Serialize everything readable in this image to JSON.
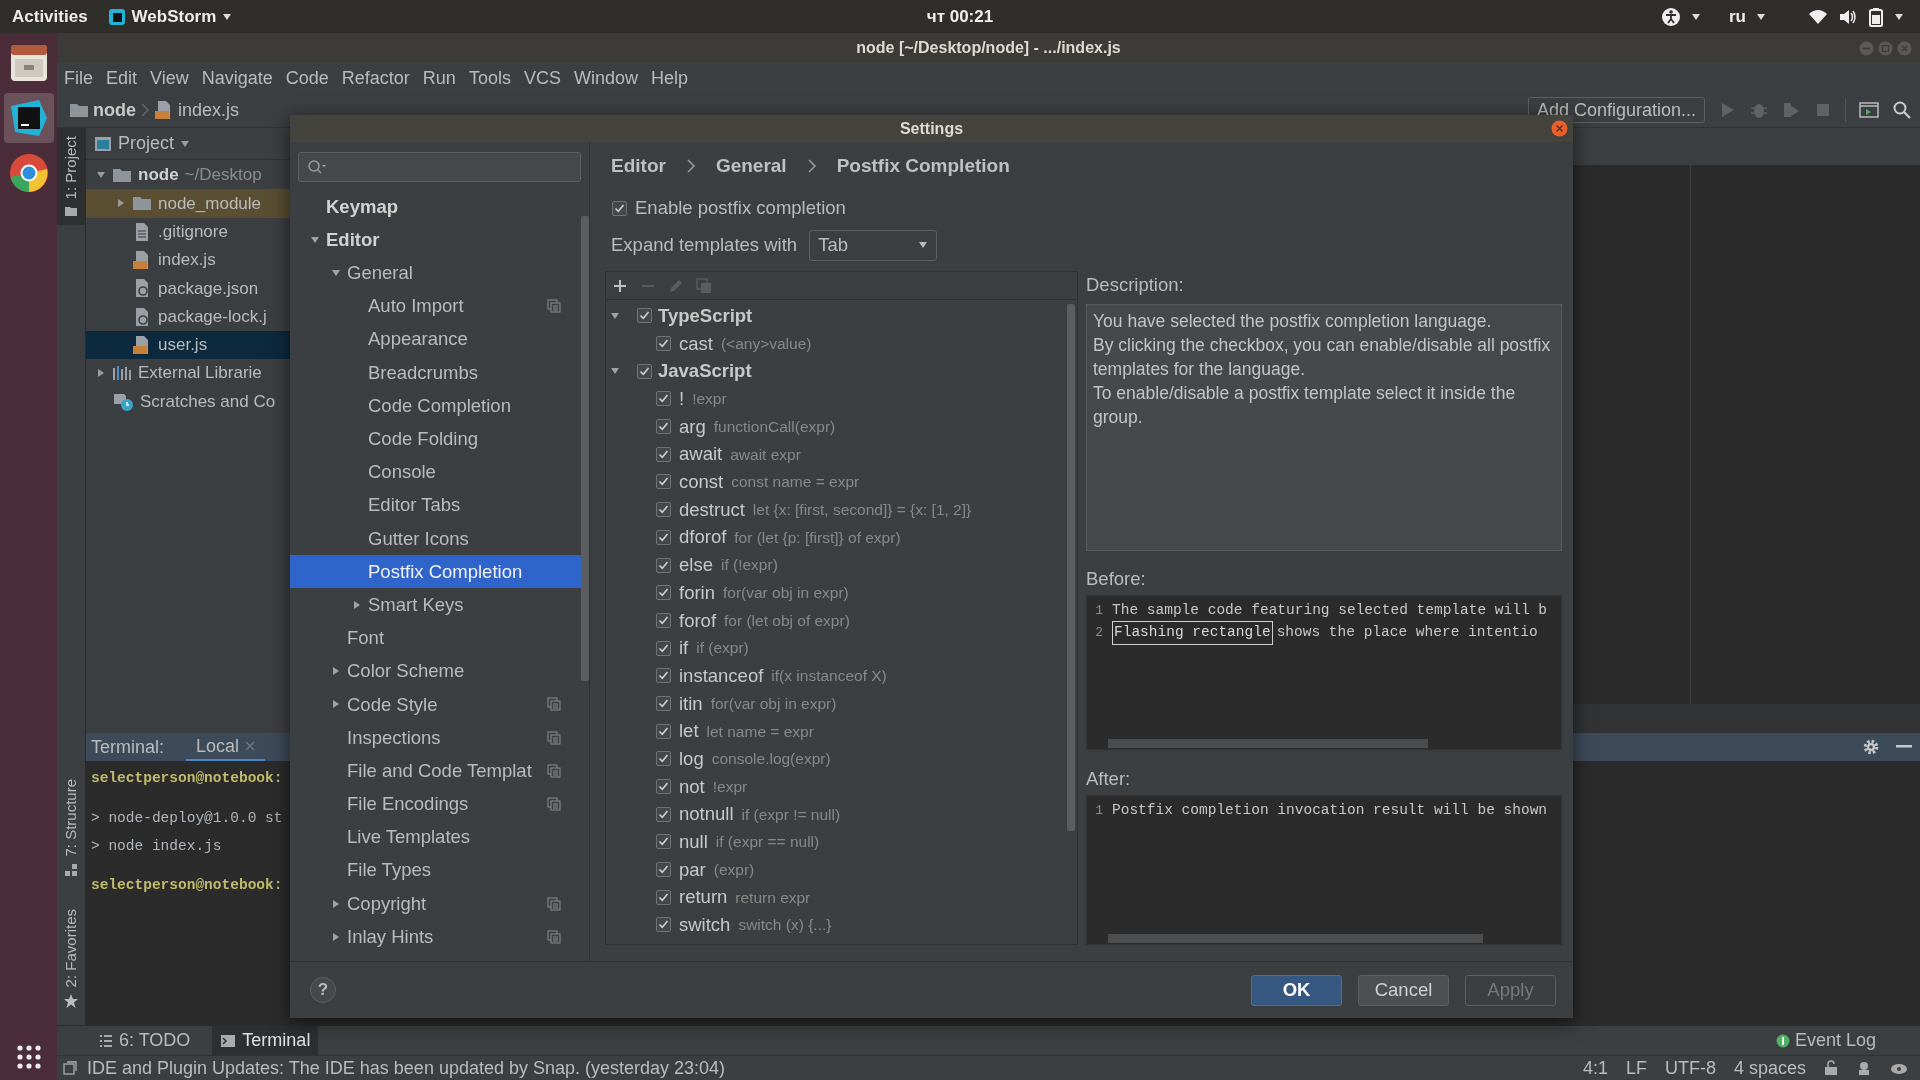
{
  "top_bar": {
    "activities": "Activities",
    "app": "WebStorm",
    "clock": "чт 00:21",
    "language": "ru"
  },
  "window": {
    "title": "node [~/Desktop/node] - .../index.js"
  },
  "menu": [
    "File",
    "Edit",
    "View",
    "Navigate",
    "Code",
    "Refactor",
    "Run",
    "Tools",
    "VCS",
    "Window",
    "Help"
  ],
  "nav": {
    "crumbs": [
      "node",
      "index.js"
    ],
    "run_config": "Add Configuration..."
  },
  "tool_strip": [
    {
      "label": "1: Project",
      "selected": true
    },
    {
      "label": "7: Structure",
      "selected": false
    },
    {
      "label": "2: Favorites",
      "selected": false
    }
  ],
  "project": {
    "title": "Project",
    "tree": [
      {
        "name": "node",
        "detail": "~/Desktop",
        "kind": "folder",
        "expanded": true,
        "selected": false,
        "excluded": false,
        "children": [
          {
            "name": "node_module",
            "kind": "folder",
            "expanded": false,
            "selected": false,
            "excluded": true
          },
          {
            "name": ".gitignore",
            "kind": "text",
            "selected": false,
            "excluded": false
          },
          {
            "name": "index.js",
            "kind": "js",
            "selected": false,
            "excluded": false
          },
          {
            "name": "package.json",
            "kind": "json",
            "selected": false,
            "excluded": false
          },
          {
            "name": "package-lock.j",
            "kind": "json",
            "selected": false,
            "excluded": false
          },
          {
            "name": "user.js",
            "kind": "js",
            "selected": true,
            "excluded": false
          }
        ]
      },
      {
        "name": "External Librarie",
        "kind": "libraries",
        "expanded": false,
        "selected": false,
        "excluded": false
      },
      {
        "name": "Scratches and Co",
        "kind": "scratches",
        "selected": false,
        "excluded": false
      }
    ]
  },
  "terminal": {
    "title": "Terminal:",
    "tabs": [
      {
        "label": "Local",
        "selected": true
      }
    ],
    "blocks": [
      {
        "kind": "prompt",
        "lines": [
          "selectperson@notebook:"
        ]
      },
      {
        "kind": "output",
        "lines": [
          "> node-deploy@1.0.0 st",
          "> node index.js"
        ]
      },
      {
        "kind": "prompt",
        "lines": [
          "selectperson@notebook:"
        ]
      }
    ]
  },
  "bottom_tools": [
    {
      "label": "6: TODO",
      "kind": "todo",
      "selected": false
    },
    {
      "label": "Terminal",
      "kind": "terminal",
      "selected": true
    }
  ],
  "event_log": "Event Log",
  "status_bar": {
    "message": "IDE and Plugin Updates: The IDE has been updated by Snap. (yesterday 23:04)",
    "items": [
      "4:1",
      "LF",
      "UTF-8",
      "4 spaces"
    ]
  },
  "settings_dialog": {
    "title": "Settings",
    "tree": [
      {
        "label": "Keymap",
        "selected": false,
        "project_icon": false
      },
      {
        "label": "Editor",
        "expanded": true,
        "selected": false,
        "project_icon": false,
        "children": [
          {
            "label": "General",
            "expanded": true,
            "selected": false,
            "project_icon": false,
            "children": [
              {
                "label": "Auto Import",
                "selected": false,
                "project_icon": true
              },
              {
                "label": "Appearance",
                "selected": false,
                "project_icon": false
              },
              {
                "label": "Breadcrumbs",
                "selected": false,
                "project_icon": false
              },
              {
                "label": "Code Completion",
                "selected": false,
                "project_icon": false
              },
              {
                "label": "Code Folding",
                "selected": false,
                "project_icon": false
              },
              {
                "label": "Console",
                "selected": false,
                "project_icon": false
              },
              {
                "label": "Editor Tabs",
                "selected": false,
                "project_icon": false
              },
              {
                "label": "Gutter Icons",
                "selected": false,
                "project_icon": false
              },
              {
                "label": "Postfix Completion",
                "selected": true,
                "project_icon": false
              },
              {
                "label": "Smart Keys",
                "expanded": false,
                "selected": false,
                "project_icon": false
              }
            ]
          },
          {
            "label": "Font",
            "selected": false,
            "project_icon": false
          },
          {
            "label": "Color Scheme",
            "expanded": false,
            "selected": false,
            "project_icon": false
          },
          {
            "label": "Code Style",
            "expanded": false,
            "selected": false,
            "project_icon": true
          },
          {
            "label": "Inspections",
            "selected": false,
            "project_icon": true
          },
          {
            "label": "File and Code Templat",
            "selected": false,
            "project_icon": true
          },
          {
            "label": "File Encodings",
            "selected": false,
            "project_icon": true
          },
          {
            "label": "Live Templates",
            "selected": false,
            "project_icon": false
          },
          {
            "label": "File Types",
            "selected": false,
            "project_icon": false
          },
          {
            "label": "Copyright",
            "expanded": false,
            "selected": false,
            "project_icon": true
          },
          {
            "label": "Inlay Hints",
            "expanded": false,
            "selected": false,
            "project_icon": true
          }
        ]
      }
    ],
    "breadcrumb": [
      "Editor",
      "General",
      "Postfix Completion"
    ],
    "enable": {
      "label": "Enable postfix completion",
      "checked": true
    },
    "expand": {
      "label": "Expand templates with",
      "value": "Tab"
    },
    "toolbar": [
      {
        "kind": "add",
        "disabled": false
      },
      {
        "kind": "remove",
        "disabled": true
      },
      {
        "kind": "edit",
        "disabled": true
      },
      {
        "kind": "copy",
        "disabled": true
      }
    ],
    "templates": [
      {
        "name": "TypeScript",
        "checked": true,
        "expanded": true,
        "children": [
          {
            "name": "cast",
            "example": "(<any>value)",
            "checked": true
          }
        ]
      },
      {
        "name": "JavaScript",
        "checked": true,
        "expanded": true,
        "children": [
          {
            "name": "!",
            "example": "!expr",
            "checked": true
          },
          {
            "name": "arg",
            "example": "functionCall(expr)",
            "checked": true
          },
          {
            "name": "await",
            "example": "await expr",
            "checked": true
          },
          {
            "name": "const",
            "example": "const name = expr",
            "checked": true
          },
          {
            "name": "destruct",
            "example": "let {x: [first, second]} = {x: [1, 2]}",
            "checked": true
          },
          {
            "name": "dforof",
            "example": "for (let {p: [first]} of expr)",
            "checked": true
          },
          {
            "name": "else",
            "example": "if (!expr)",
            "checked": true
          },
          {
            "name": "forin",
            "example": "for(var obj in expr)",
            "checked": true
          },
          {
            "name": "forof",
            "example": "for (let obj of expr)",
            "checked": true
          },
          {
            "name": "if",
            "example": "if (expr)",
            "checked": true
          },
          {
            "name": "instanceof",
            "example": "if(x instanceof X)",
            "checked": true
          },
          {
            "name": "itin",
            "example": "for(var obj in expr)",
            "checked": true
          },
          {
            "name": "let",
            "example": "let name = expr",
            "checked": true
          },
          {
            "name": "log",
            "example": "console.log(expr)",
            "checked": true
          },
          {
            "name": "not",
            "example": "!expr",
            "checked": true
          },
          {
            "name": "notnull",
            "example": "if (expr != null)",
            "checked": true
          },
          {
            "name": "null",
            "example": "if (expr == null)",
            "checked": true
          },
          {
            "name": "par",
            "example": "(expr)",
            "checked": true
          },
          {
            "name": "return",
            "example": "return expr",
            "checked": true
          },
          {
            "name": "switch",
            "example": "switch (x) {...}",
            "checked": true
          }
        ]
      }
    ],
    "description": {
      "label": "Description:",
      "paragraphs": [
        "You have selected the postfix completion language.",
        "By clicking the checkbox, you can enable/disable all postfix templates for the language.",
        "To enable/disable a postfix template select it inside the group."
      ]
    },
    "before": {
      "label": "Before:",
      "lines": [
        {
          "number": "1",
          "segments": [
            {
              "text": "The sample code featuring selected template will b",
              "boxed": false
            }
          ]
        },
        {
          "number": "2",
          "segments": [
            {
              "text": "Flashing rectangle",
              "boxed": true
            },
            {
              "text": "shows the place where intentio",
              "boxed": false
            }
          ]
        }
      ]
    },
    "after": {
      "label": "After:",
      "lines": [
        {
          "number": "1",
          "segments": [
            {
              "text": "Postfix completion invocation result will be shown",
              "boxed": false
            }
          ]
        }
      ]
    },
    "help": "?",
    "buttons": [
      {
        "label": "OK",
        "kind": "primary"
      },
      {
        "label": "Cancel",
        "kind": "normal"
      },
      {
        "label": "Apply",
        "kind": "disabled"
      }
    ]
  }
}
